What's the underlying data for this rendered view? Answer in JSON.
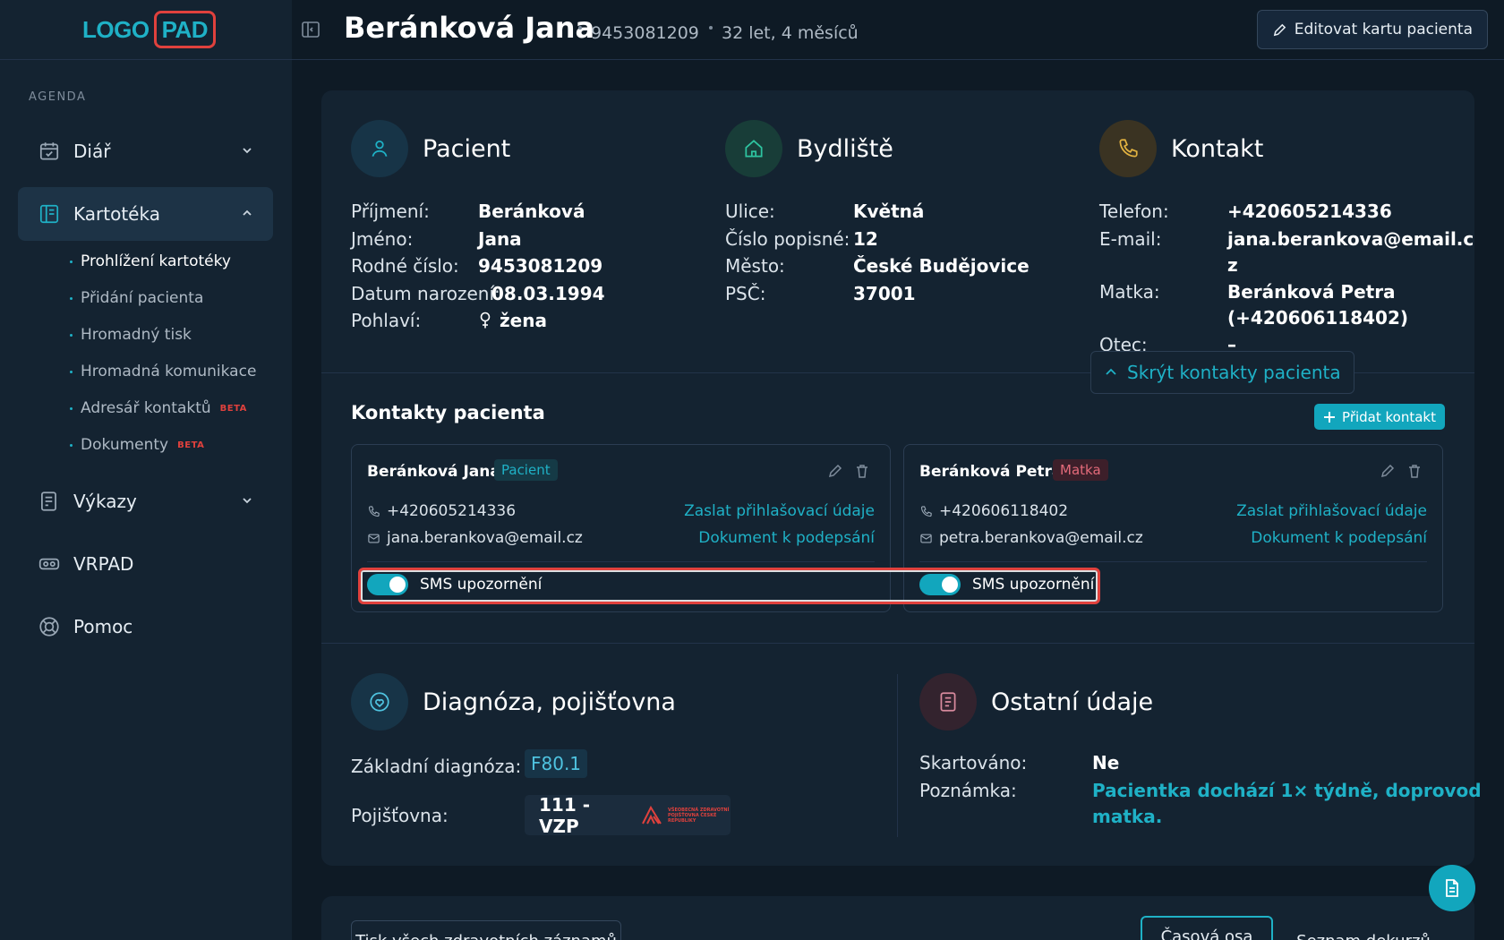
{
  "logo": {
    "part1": "LOGO",
    "part2": "PAD"
  },
  "sidebar": {
    "section_label": "AGENDA",
    "items": [
      {
        "label": "Diář",
        "icon": "calendar-check-icon"
      },
      {
        "label": "Kartotéka",
        "icon": "book-icon"
      },
      {
        "label": "Výkazy",
        "icon": "report-icon"
      },
      {
        "label": "VRPAD",
        "icon": "vr-headset-icon"
      },
      {
        "label": "Pomoc",
        "icon": "lifebuoy-icon"
      }
    ],
    "sub_items": [
      {
        "label": "Prohlížení kartotéky"
      },
      {
        "label": "Přidání pacienta"
      },
      {
        "label": "Hromadný tisk"
      },
      {
        "label": "Hromadná komunikace"
      },
      {
        "label": "Adresář kontaktů",
        "badge": "BETA"
      },
      {
        "label": "Dokumenty",
        "badge": "BETA"
      }
    ]
  },
  "header": {
    "name": "Beránková Jana",
    "birth_number": "9453081209",
    "age": "32 let, 4 měsíců",
    "edit_label": "Editovat kartu pacienta"
  },
  "patient": {
    "title": "Pacient",
    "fields": [
      {
        "k": "Příjmení:",
        "v": "Beránková"
      },
      {
        "k": "Jméno:",
        "v": "Jana"
      },
      {
        "k": "Rodné číslo:",
        "v": "9453081209"
      },
      {
        "k": "Datum narození:",
        "v": "08.03.1994"
      },
      {
        "k": "Pohlaví:",
        "v": "žena"
      }
    ]
  },
  "address": {
    "title": "Bydliště",
    "fields": [
      {
        "k": "Ulice:",
        "v": "Květná"
      },
      {
        "k": "Číslo popisné:",
        "v": "12"
      },
      {
        "k": "Město:",
        "v": "České Budějovice"
      },
      {
        "k": "PSČ:",
        "v": "37001"
      }
    ]
  },
  "contact": {
    "title": "Kontakt",
    "fields": [
      {
        "k": "Telefon:",
        "v": "+420605214336"
      },
      {
        "k": "E-mail:",
        "v1": "jana.berankova@email.c",
        "v2": "z"
      },
      {
        "k": "Matka:",
        "v1": "Beránková Petra",
        "v2": "(+420606118402)"
      },
      {
        "k": "Otec:",
        "v": "–"
      }
    ],
    "hide_label": "Skrýt kontakty pacienta"
  },
  "patient_contacts": {
    "title": "Kontakty pacienta",
    "add_label": "Přidat kontakt",
    "cards": [
      {
        "name": "Beránková Jana",
        "role": "Pacient",
        "phone": "+420605214336",
        "email": "jana.berankova@email.cz",
        "link1": "Zaslat přihlašovací údaje",
        "link2": "Dokument k podepsání",
        "sms_label": "SMS upozornění"
      },
      {
        "name": "Beránková Petra",
        "role": "Matka",
        "phone": "+420606118402",
        "email": "petra.berankova@email.cz",
        "link1": "Zaslat přihlašovací údaje",
        "link2": "Dokument k podepsání",
        "sms_label": "SMS upozornění"
      }
    ]
  },
  "diagnosis": {
    "title": "Diagnóza, pojišťovna",
    "diag_label": "Základní diagnóza:",
    "diag_code": "F80.1",
    "ins_label": "Pojišťovna:",
    "ins_value": "111 - VZP",
    "ins_logo_text": "VŠEOBECNÁ ZDRAVOTNÍ POJIŠŤOVNA ČESKÉ REPUBLIKY"
  },
  "other": {
    "title": "Ostatní údaje",
    "fields": [
      {
        "k": "Skartováno:",
        "v": "Ne"
      },
      {
        "k": "Poznámka:",
        "v1": "Pacientka dochází 1× týdně, doprovod",
        "v2": "matka."
      }
    ]
  },
  "bottom": {
    "print_label": "Tisk všech zdravotních záznamů",
    "timeline_label": "Časová osa",
    "list_label": "Seznam dekurzů"
  },
  "colors": {
    "accent": "#1fb1c6",
    "highlight": "#e0413d",
    "bg": "#0e1a25",
    "panel": "#142331"
  }
}
